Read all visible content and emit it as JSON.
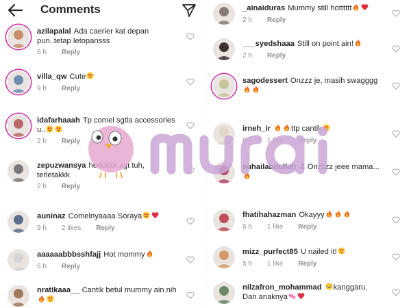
{
  "header": {
    "title": "Comments",
    "back_icon": "back-arrow-icon",
    "send_icon": "send-icon"
  },
  "left_comments": [
    {
      "username": "azilapalal",
      "text": "Ada caerier kat depan pun..tetap letopansss",
      "emoji": [],
      "time": "6 h",
      "likes": "",
      "reply": "Reply"
    },
    {
      "username": "villa_qw",
      "text": "Cute",
      "emoji": [
        "heart-eyes"
      ],
      "time": "9 h",
      "likes": "",
      "reply": "Reply"
    },
    {
      "username": "idafarhaaah",
      "text": "Tp comel sgtla accessories u..",
      "emoji": [
        "heart-eyes",
        "heart-eyes"
      ],
      "time": "2 h",
      "likes": "",
      "reply": "Reply"
    },
    {
      "username": "zepuzwansya",
      "text": "herlokkk sgt tuh, terletakkk",
      "emoji": [],
      "time": "2 h",
      "likes": "",
      "reply": "Reply"
    },
    {
      "username": "auninaz",
      "text": "Comelnyaaaa Soraya",
      "emoji": [
        "heart-eyes",
        "red-heart"
      ],
      "time": "9 h",
      "likes": "2 likes",
      "reply": "Reply"
    },
    {
      "username": "aaaaaabbbsshfajj",
      "text": "Hot mommy",
      "emoji": [
        "fire"
      ],
      "time": "5 h",
      "likes": "",
      "reply": "Reply"
    },
    {
      "username": "nratikaaa__",
      "text": "Cantik betul mummy ain nih",
      "emoji": [
        "fire",
        "heart-eyes"
      ],
      "time": "",
      "likes": "",
      "reply": ""
    }
  ],
  "right_comments": [
    {
      "username": "_ainaiduras",
      "text": "Mummy still hotttttt",
      "emoji": [
        "fire",
        "red-heart"
      ],
      "time": "2 h",
      "likes": "",
      "reply": "Reply"
    },
    {
      "username": "___syedshaaa",
      "text": "Still on point ain!",
      "emoji": [
        "fire"
      ],
      "time": "2 h",
      "likes": "",
      "reply": "Reply"
    },
    {
      "username": "sagodessert",
      "text": "Onzzz je, masih swagggg",
      "emoji": [
        "fire",
        "fire"
      ],
      "time": "",
      "likes": "",
      "reply": ""
    },
    {
      "username": "irneh_ir",
      "text": "ttp cantik",
      "emoji_before": [
        "fire",
        "fire"
      ],
      "emoji": [
        "heart-eyes"
      ],
      "time": "6 h",
      "likes": "1 like",
      "reply": "Reply"
    },
    {
      "username": "suhailabdullah_2",
      "text": "Onzzzz jeee mama...",
      "emoji": [
        "fire"
      ],
      "time": "",
      "likes": "",
      "reply": ""
    },
    {
      "username": "fhatihahazman",
      "text": "Okayyy",
      "emoji": [
        "fire",
        "fire",
        "fire"
      ],
      "time": "6 h",
      "likes": "1 like",
      "reply": "Reply"
    },
    {
      "username": "mizz_purfect85",
      "text": "U nailed it!",
      "emoji": [
        "heart-eyes"
      ],
      "time": "5 h",
      "likes": "1 like",
      "reply": "Reply"
    },
    {
      "username": "nilzafron_mohammad",
      "text": "kanggaru. Dan anaknya",
      "emoji_before": [
        "laughing"
      ],
      "emoji": [
        "pink-hearts",
        "red-heart"
      ],
      "time": "",
      "likes": "",
      "reply": ""
    }
  ],
  "watermark": {
    "text": "murai",
    "mascot_icon": "owl-mascot-icon",
    "color": "#c9a6d6"
  },
  "colors": {
    "story_ring": "#d6249f",
    "meta_gray": "#8e8e8e",
    "text": "#262626"
  }
}
